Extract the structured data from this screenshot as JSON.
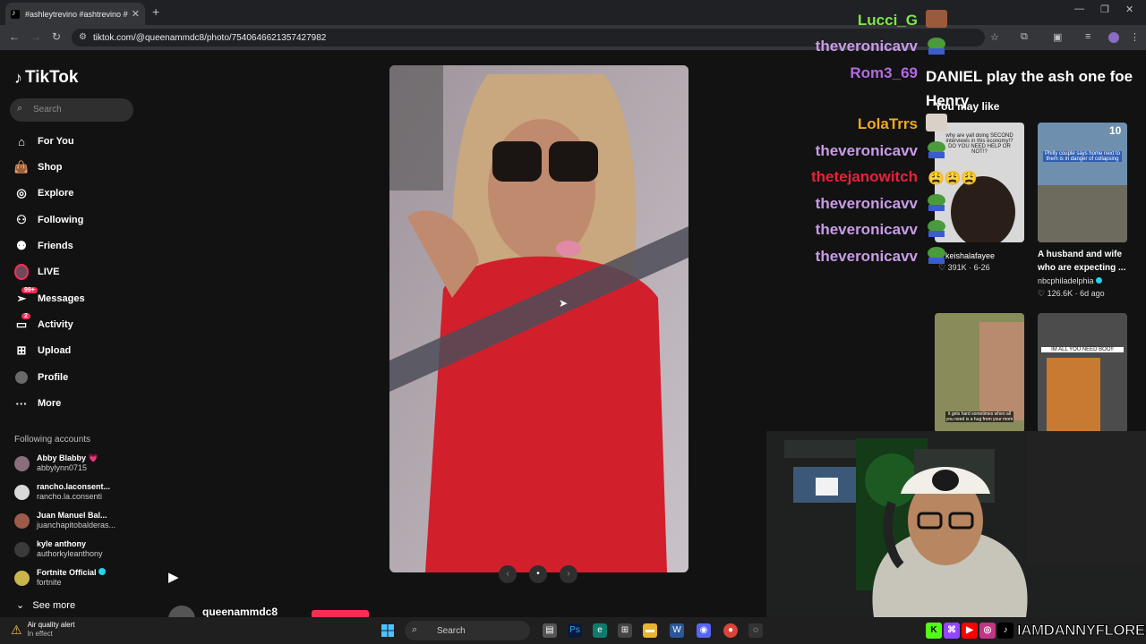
{
  "browser": {
    "tab_title": "#ashleytrevino #ashtrevino #a",
    "url": "tiktok.com/@queenammdc8/photo/7540646621357427982"
  },
  "tiktok": {
    "logo_text": "TikTok",
    "search_placeholder": "Search",
    "nav": [
      {
        "label": "For You",
        "icon": "home-icon"
      },
      {
        "label": "Shop",
        "icon": "shop-bag-icon"
      },
      {
        "label": "Explore",
        "icon": "compass-icon"
      },
      {
        "label": "Following",
        "icon": "person-plus-icon"
      },
      {
        "label": "Friends",
        "icon": "friends-icon"
      },
      {
        "label": "LIVE",
        "icon": "live-icon"
      },
      {
        "label": "Messages",
        "icon": "paper-plane-icon",
        "badge": "99+"
      },
      {
        "label": "Activity",
        "icon": "activity-icon",
        "badge": "2"
      },
      {
        "label": "Upload",
        "icon": "plus-square-icon"
      },
      {
        "label": "Profile",
        "icon": "profile-avatar-icon"
      },
      {
        "label": "More",
        "icon": "more-dots-icon"
      }
    ],
    "following_header": "Following accounts",
    "accounts": [
      {
        "name": "Abby Blabby 💗",
        "handle": "abbylynn0715",
        "color": "#8a6f7a"
      },
      {
        "name": "rancho.laconsent...",
        "handle": "rancho.la.consenti",
        "color": "#d9d9d9"
      },
      {
        "name": "Juan Manuel Bal...",
        "handle": "juanchapitobalderas...",
        "color": "#9b5a4a"
      },
      {
        "name": "kyle anthony",
        "handle": "authorkyleanthony",
        "color": "#3a3a3a"
      },
      {
        "name": "Fortnite Official",
        "handle": "fortnite",
        "color": "#c9b54a"
      }
    ],
    "see_more": "See more",
    "post_author": "queenammdc8",
    "you_may_like": "You may like",
    "recommendations": [
      {
        "title": "",
        "author": "keishalafayee",
        "meta": "391K · 6-26",
        "overlay": "why are yall doing SECOND interviews in this economy!? DO YOU NEED HELP OR NOT!?"
      },
      {
        "title": "A husband and wife who are expecting ...",
        "author": "nbcphiladelphia",
        "meta": "126.6K · 6d ago",
        "overlay": "Philly couple says home next to them is in danger of collapsing",
        "counter": "10"
      },
      {
        "title": "",
        "author": "",
        "meta": "",
        "overlay": "it gets hard sometimes when all you need is a hug from your mom"
      },
      {
        "title": "",
        "author": "",
        "meta": "",
        "overlay": "IM ALL YOU NEED BOO!!"
      }
    ]
  },
  "chat": [
    {
      "user": "Lucci_G",
      "color": "#7ee64a",
      "message": ""
    },
    {
      "user": "theveronicavv",
      "color": "#c99be8",
      "message": ""
    },
    {
      "user": "Rom3_69",
      "color": "#b36ae0",
      "message": "DANIEL play the ash one foe Henry"
    },
    {
      "user": "LolaTrrs",
      "color": "#f0a81f",
      "message": ""
    },
    {
      "user": "theveronicavv",
      "color": "#c99be8",
      "message": ""
    },
    {
      "user": "thetejanowitch",
      "color": "#e8213a",
      "message": "😩😩😩"
    },
    {
      "user": "theveronicavv",
      "color": "#c99be8",
      "message": ""
    },
    {
      "user": "theveronicavv",
      "color": "#c99be8",
      "message": ""
    },
    {
      "user": "theveronicavv",
      "color": "#c99be8",
      "message": ""
    }
  ],
  "taskbar": {
    "weather_title": "Air quality alert",
    "weather_sub": "In effect",
    "search": "Search"
  },
  "stream": {
    "handle": "IAMDANNYFLORES"
  }
}
